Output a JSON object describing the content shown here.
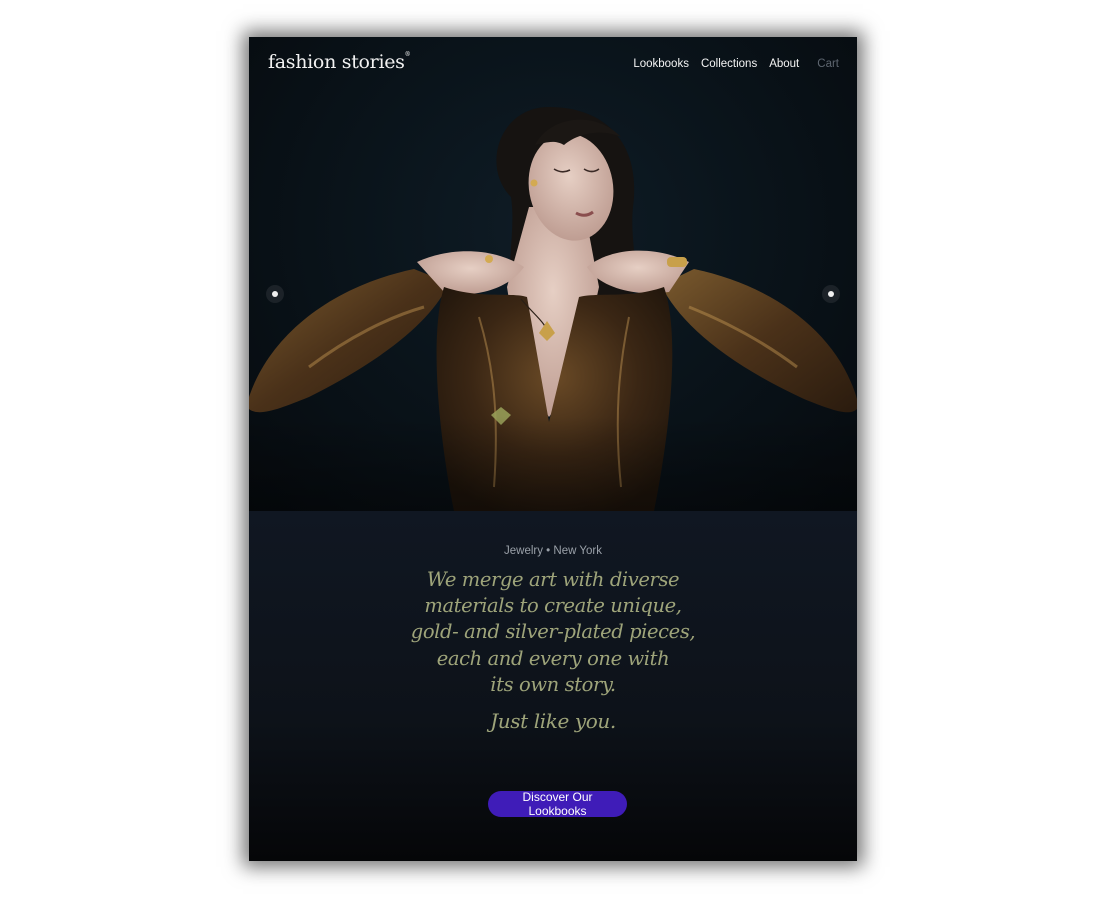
{
  "brand": {
    "logo_text": "fashion stories",
    "trademark": "®"
  },
  "nav": {
    "items": [
      {
        "label": "Lookbooks"
      },
      {
        "label": "Collections"
      },
      {
        "label": "About"
      }
    ],
    "cart_label": "Cart"
  },
  "hero": {
    "image_icon": "model-portrait-image",
    "prev_icon": "carousel-prev-dot-icon",
    "next_icon": "carousel-next-dot-icon"
  },
  "content": {
    "meta": "Jewelry • New York",
    "quote_lines": [
      "We merge art with diverse",
      "materials to create unique,",
      "gold- and silver-plated pieces,",
      "each and every one with",
      "its own story."
    ],
    "tagline": "Just like you.",
    "cta_label": "Discover Our Lookbooks"
  },
  "colors": {
    "accent": "#3f1cb8",
    "quote_text": "#9ea47a",
    "background": "#07090c"
  }
}
